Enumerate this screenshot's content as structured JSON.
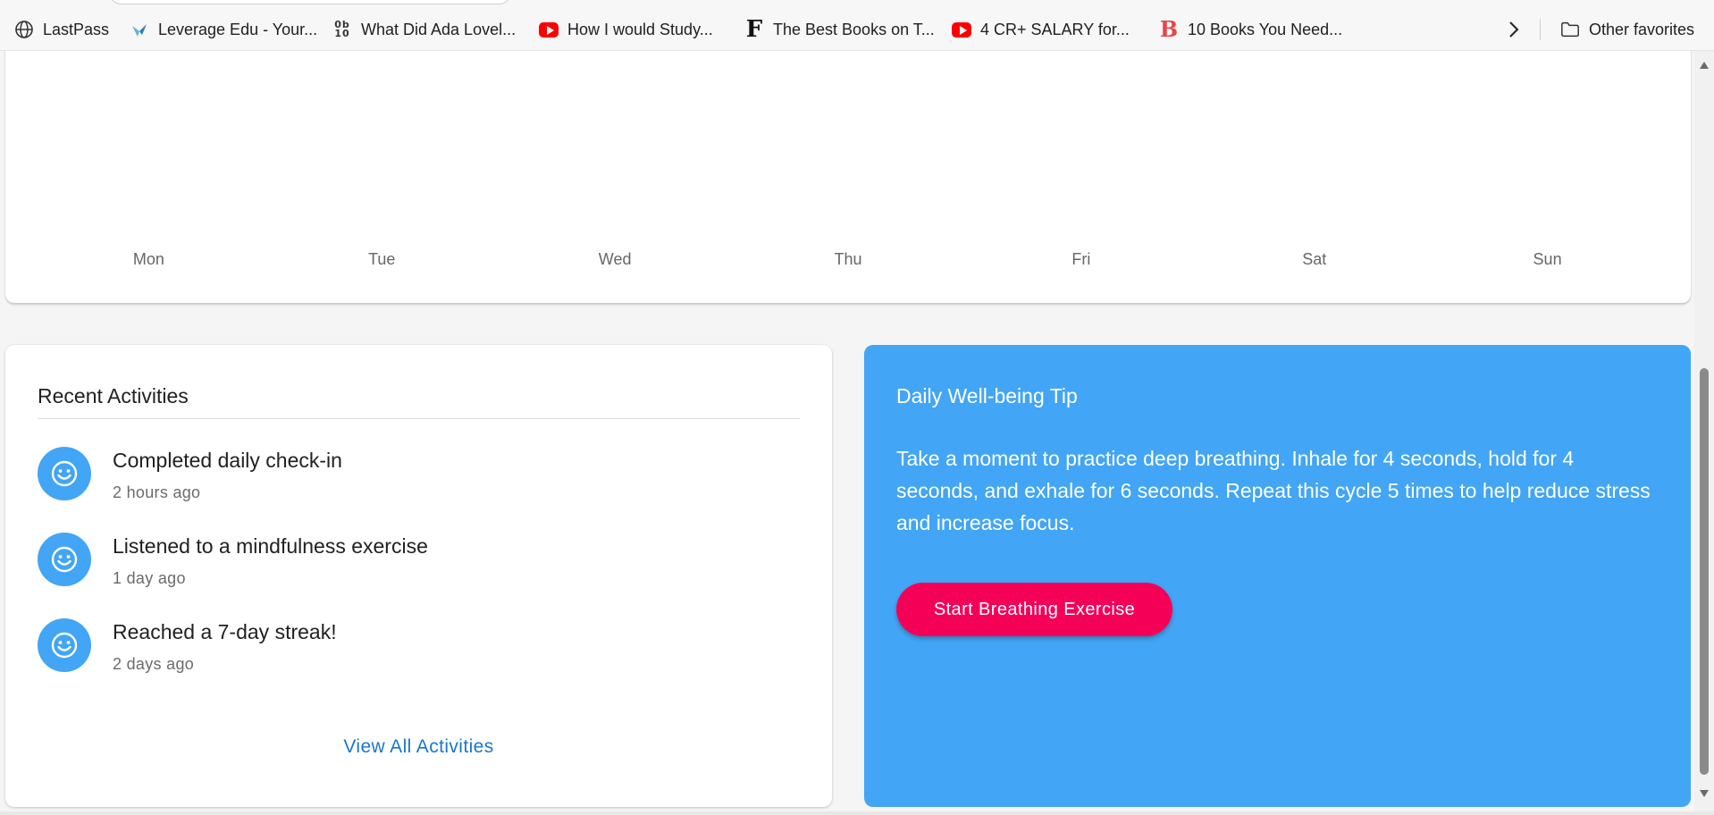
{
  "bookmarks": {
    "items": [
      {
        "label": "LastPass",
        "icon": "globe-icon"
      },
      {
        "label": "Leverage Edu - Your...",
        "icon": "leverage-edu-icon"
      },
      {
        "label": "What Did Ada Lovel...",
        "icon": "ob10-icon"
      },
      {
        "label": "How I would Study...",
        "icon": "youtube-icon"
      },
      {
        "label": "The Best Books on T...",
        "icon": "f-letter-icon"
      },
      {
        "label": "4 CR+ SALARY for...",
        "icon": "youtube-icon"
      },
      {
        "label": "10 Books You Need...",
        "icon": "b-letter-icon"
      }
    ],
    "other_favorites": "Other favorites",
    "icon_glyphs": {
      "ob10": "0b\n10",
      "f_letter": "F",
      "b_letter": "B"
    }
  },
  "weekly_chart": {
    "days": [
      "Mon",
      "Tue",
      "Wed",
      "Thu",
      "Fri",
      "Sat",
      "Sun"
    ]
  },
  "recent_activities": {
    "title": "Recent Activities",
    "items": [
      {
        "title": "Completed daily check-in",
        "time": "2 hours ago",
        "icon": "smiley-icon"
      },
      {
        "title": "Listened to a mindfulness exercise",
        "time": "1 day ago",
        "icon": "smiley-icon"
      },
      {
        "title": "Reached a 7-day streak!",
        "time": "2 days ago",
        "icon": "smiley-icon"
      }
    ],
    "view_all": "View All Activities"
  },
  "tip": {
    "title": "Daily Well-being Tip",
    "body": "Take a moment to practice deep breathing. Inhale for 4 seconds, hold for 4 seconds, and exhale for 6 seconds. Repeat this cycle 5 times to help reduce stress and increase focus.",
    "button": "Start Breathing Exercise"
  },
  "colors": {
    "accent_blue": "#42a5f5",
    "button_pink": "#f50057",
    "link_blue": "#1976d2"
  }
}
